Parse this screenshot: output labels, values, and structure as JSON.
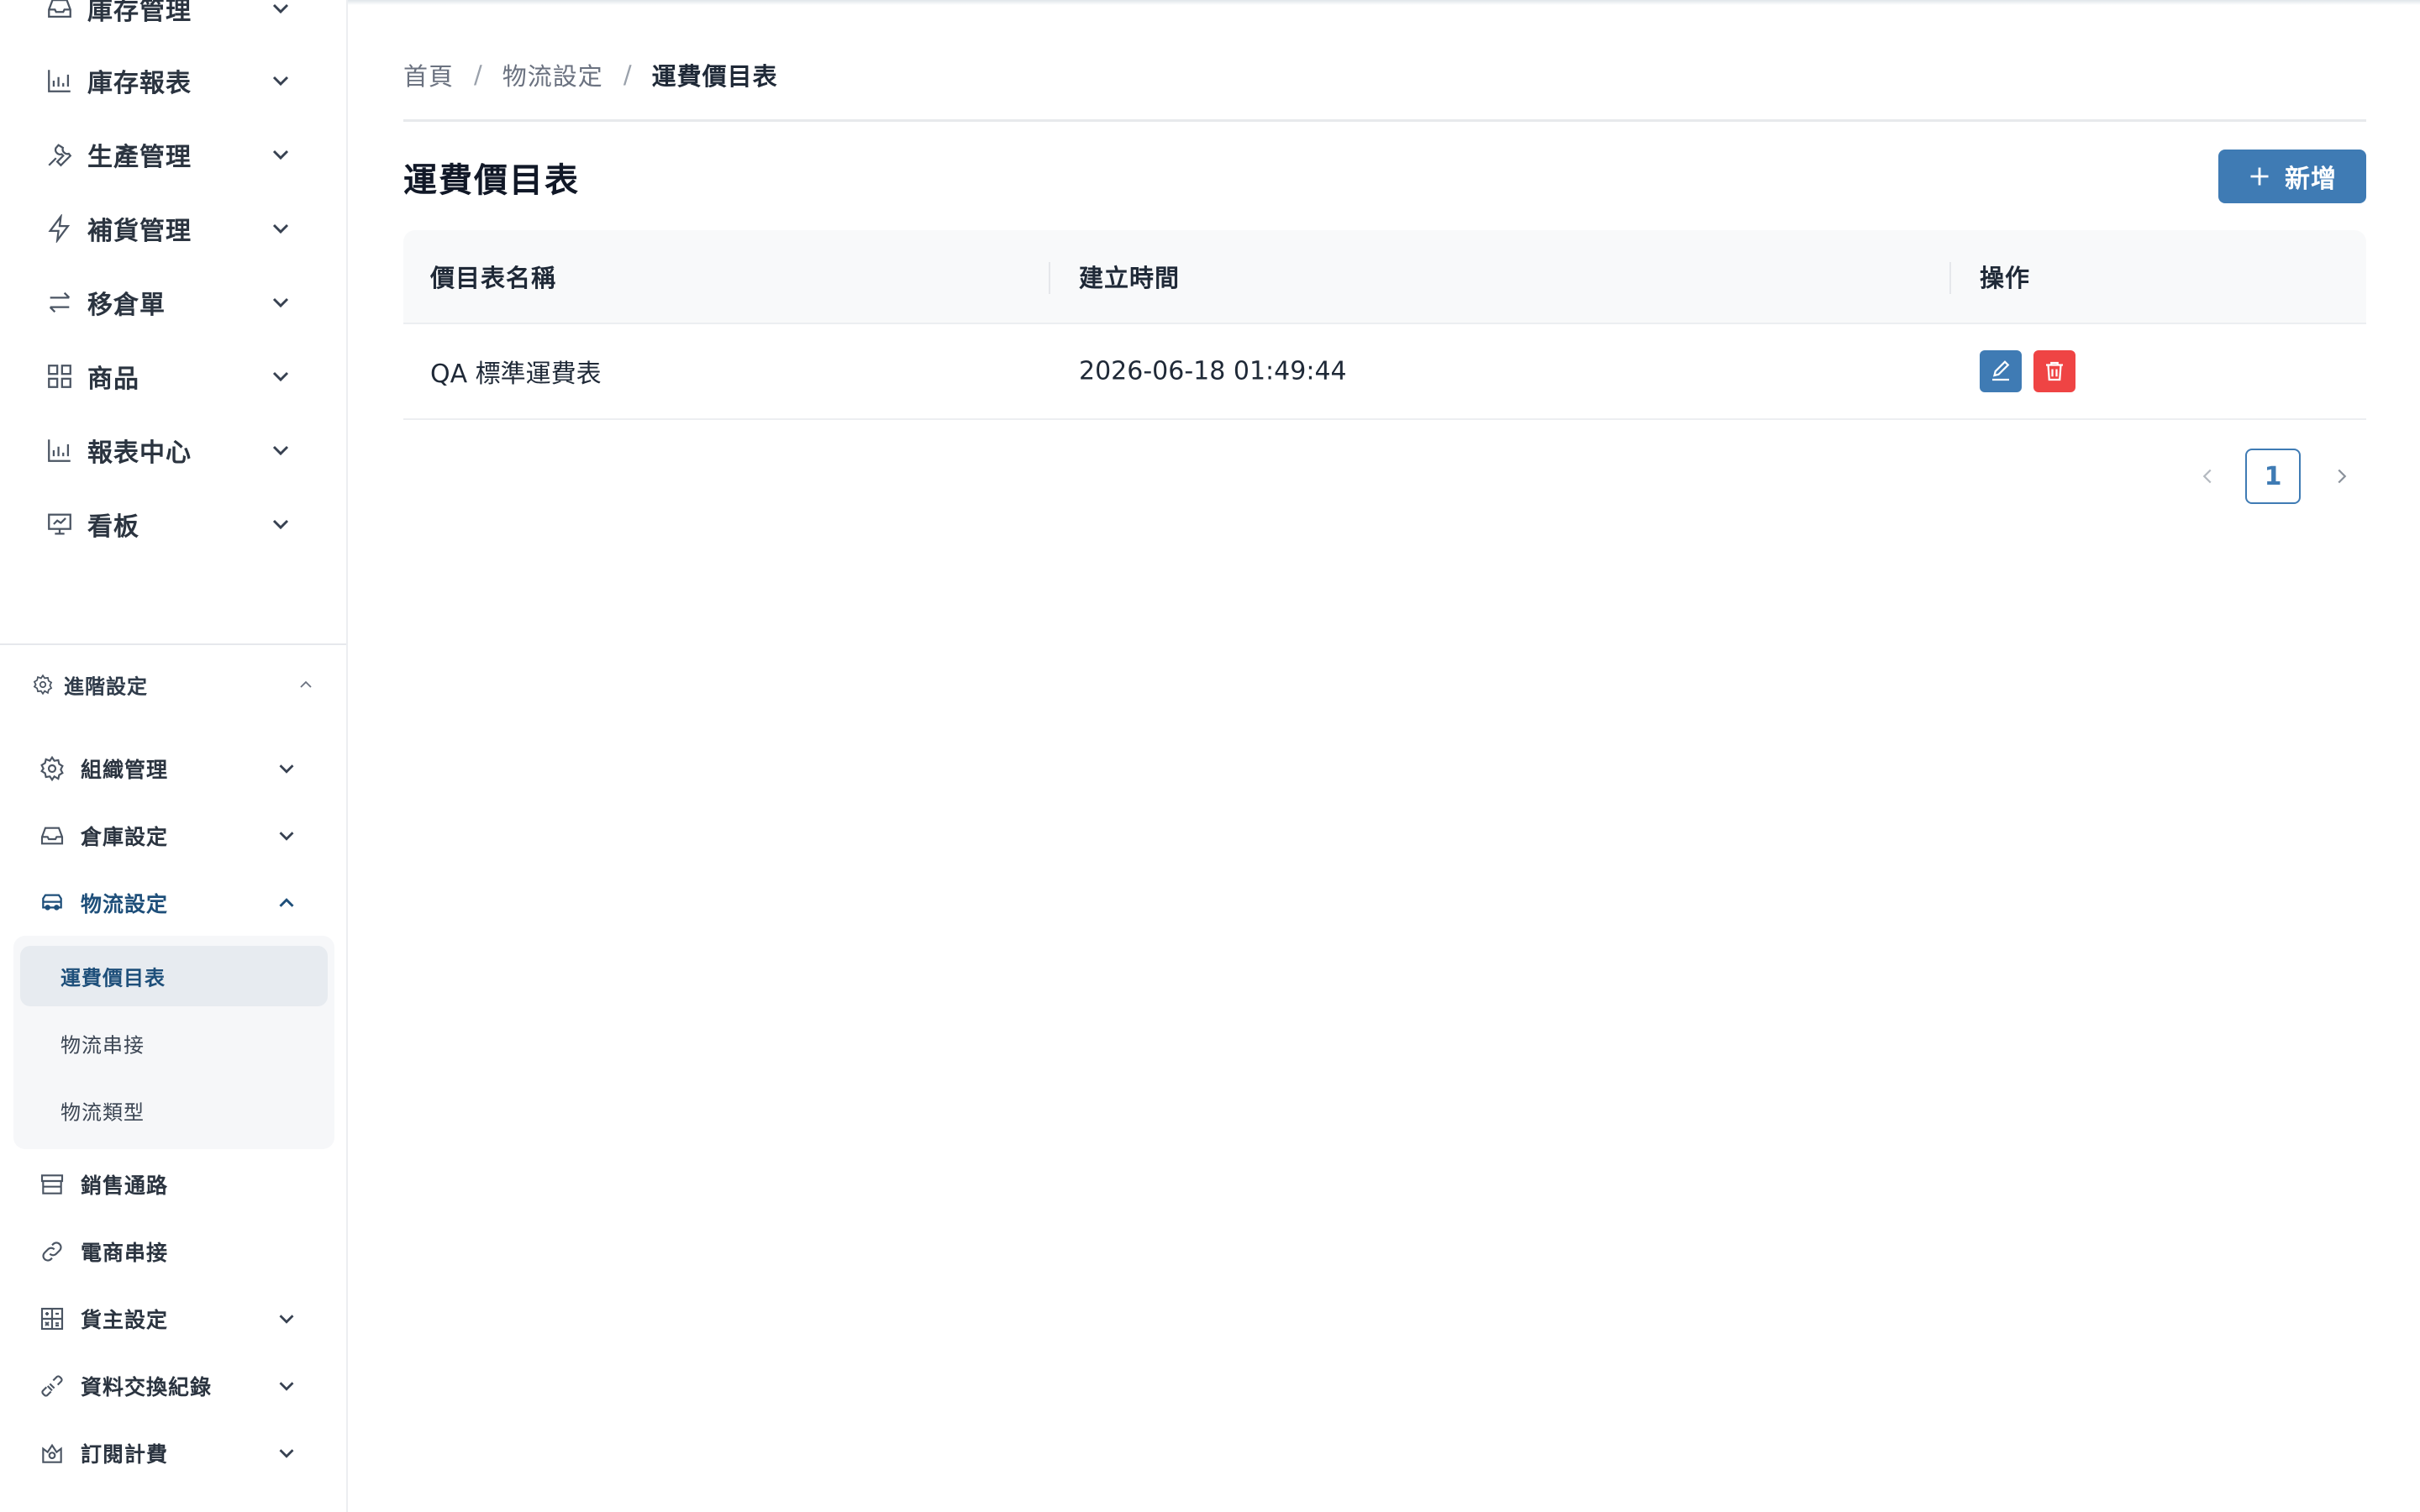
{
  "sidebar": {
    "top_items": [
      {
        "label": "庫存管理",
        "icon": "inbox-icon"
      },
      {
        "label": "庫存報表",
        "icon": "bar-chart-icon"
      },
      {
        "label": "生產管理",
        "icon": "wrench-icon"
      },
      {
        "label": "補貨管理",
        "icon": "lightning-icon"
      },
      {
        "label": "移倉單",
        "icon": "transfer-icon"
      },
      {
        "label": "商品",
        "icon": "grid-icon"
      },
      {
        "label": "報表中心",
        "icon": "bar-chart-icon"
      },
      {
        "label": "看板",
        "icon": "presentation-icon"
      }
    ],
    "section_title": "進階設定",
    "advanced_items": [
      {
        "label": "組織管理",
        "icon": "gear-icon",
        "chevron": "down"
      },
      {
        "label": "倉庫設定",
        "icon": "inbox-icon",
        "chevron": "down"
      },
      {
        "label": "物流設定",
        "icon": "truck-icon",
        "chevron": "up"
      }
    ],
    "logistics_submenu": [
      {
        "label": "運費價目表",
        "active": true
      },
      {
        "label": "物流串接",
        "active": false
      },
      {
        "label": "物流類型",
        "active": false
      }
    ],
    "bottom_items": [
      {
        "label": "銷售通路",
        "icon": "store-icon",
        "chevron": "none"
      },
      {
        "label": "電商串接",
        "icon": "link-icon",
        "chevron": "none"
      },
      {
        "label": "貨主設定",
        "icon": "calculator-icon",
        "chevron": "down"
      },
      {
        "label": "資料交換紀錄",
        "icon": "plug-icon",
        "chevron": "down"
      },
      {
        "label": "訂閱計費",
        "icon": "badge-icon",
        "chevron": "down"
      }
    ]
  },
  "breadcrumb": {
    "home": "首頁",
    "parent": "物流設定",
    "current": "運費價目表",
    "separator": "/"
  },
  "page": {
    "title": "運費價目表",
    "add_button_label": "新增"
  },
  "table": {
    "columns": [
      "價目表名稱",
      "建立時間",
      "操作"
    ],
    "rows": [
      {
        "name": "QA 標準運費表",
        "created_at": "2026-06-18 01:49:44"
      }
    ]
  },
  "pagination": {
    "current_page": "1"
  },
  "colors": {
    "primary": "#3f7bb4",
    "danger": "#ef4444",
    "active_text": "#1e4f7a"
  }
}
